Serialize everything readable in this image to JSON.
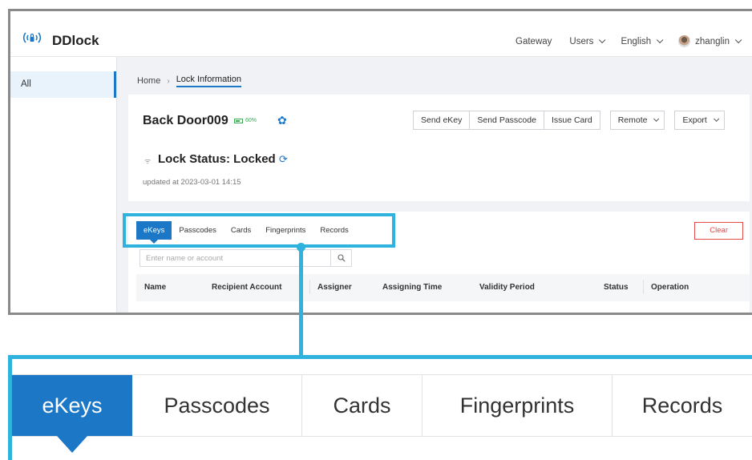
{
  "app": {
    "brand": "DDlock",
    "brand_icon": "lock-signal-icon",
    "accent_color": "#1c78c6",
    "highlight_color": "#2fb2de"
  },
  "topnav": {
    "gateway": "Gateway",
    "users": "Users",
    "language": "English",
    "username": "zhanglin"
  },
  "sidebar": {
    "items": [
      {
        "label": "All",
        "selected": true
      }
    ]
  },
  "breadcrumb": {
    "home": "Home",
    "current": "Lock Information"
  },
  "lock": {
    "name": "Back Door009",
    "battery_text": "60%",
    "battery_level": 0.6,
    "status": "Lock Status: Locked",
    "updated": "updated at 2023-03-01 14:15"
  },
  "actions": {
    "send_ekey": "Send eKey",
    "send_passcode": "Send Passcode",
    "issue_card": "Issue Card",
    "remote": "Remote",
    "export": "Export"
  },
  "tabs": [
    {
      "label": "eKeys",
      "active": true
    },
    {
      "label": "Passcodes",
      "active": false
    },
    {
      "label": "Cards",
      "active": false
    },
    {
      "label": "Fingerprints",
      "active": false
    },
    {
      "label": "Records",
      "active": false
    }
  ],
  "clear_label": "Clear",
  "search": {
    "placeholder": "Enter name or account",
    "value": ""
  },
  "table": {
    "columns": [
      "Name",
      "Recipient Account",
      "Assigner",
      "Assigning Time",
      "Validity Period",
      "Status",
      "Operation"
    ]
  }
}
